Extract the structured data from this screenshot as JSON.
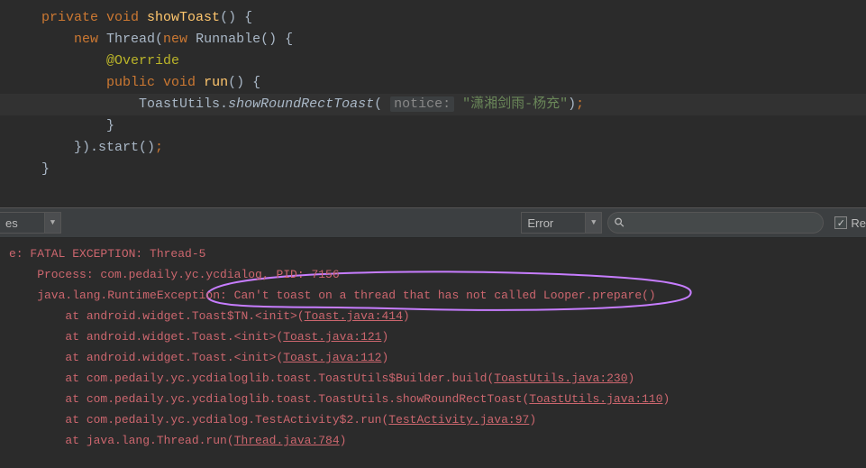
{
  "editor": {
    "lines": [
      {
        "indent": 1,
        "tokens": [
          {
            "cls": "kw",
            "t": "private void "
          },
          {
            "cls": "method-decl",
            "t": "showToast"
          },
          {
            "cls": "plain",
            "t": "() {"
          }
        ]
      },
      {
        "indent": 2,
        "tokens": [
          {
            "cls": "kw",
            "t": "new "
          },
          {
            "cls": "plain",
            "t": "Thread("
          },
          {
            "cls": "kw",
            "t": "new "
          },
          {
            "cls": "plain",
            "t": "Runnable() {"
          }
        ]
      },
      {
        "indent": 3,
        "tokens": [
          {
            "cls": "annotation",
            "t": "@Override"
          }
        ]
      },
      {
        "indent": 3,
        "tokens": [
          {
            "cls": "kw",
            "t": "public void "
          },
          {
            "cls": "method-decl",
            "t": "run"
          },
          {
            "cls": "plain",
            "t": "() {"
          }
        ]
      },
      {
        "indent": 4,
        "highlight": true,
        "tokens": [
          {
            "cls": "plain",
            "t": "ToastUtils."
          },
          {
            "cls": "static-call",
            "t": "showRoundRectToast"
          },
          {
            "cls": "plain",
            "t": "( "
          },
          {
            "cls": "param-hint",
            "t": "notice:"
          },
          {
            "cls": "plain",
            "t": " "
          },
          {
            "cls": "string",
            "t": "\"潇湘剑雨-杨充\""
          },
          {
            "cls": "plain",
            "t": ")"
          },
          {
            "cls": "kw",
            "t": ";"
          }
        ]
      },
      {
        "indent": 3,
        "tokens": [
          {
            "cls": "plain",
            "t": "}"
          }
        ]
      },
      {
        "indent": 2,
        "tokens": [
          {
            "cls": "plain",
            "t": "}).start()"
          },
          {
            "cls": "kw",
            "t": ";"
          }
        ]
      },
      {
        "indent": 1,
        "tokens": [
          {
            "cls": "plain",
            "t": "}"
          }
        ]
      }
    ]
  },
  "toolbar": {
    "left_combo": "es",
    "level": "Error",
    "regex_label": "Re"
  },
  "log": {
    "lines": [
      {
        "pad": 0,
        "pre": "e: ",
        "text": "FATAL EXCEPTION: Thread-5"
      },
      {
        "pad": 1,
        "text": "Process: com.pedaily.yc.ycdialog, PID: 7156"
      },
      {
        "pad": 1,
        "text": "java.lang.RuntimeException: Can't toast on a thread that has not called Looper.prepare()"
      },
      {
        "pad": 2,
        "text": "at android.widget.Toast$TN.<init>(",
        "link": "Toast.java:414",
        "after": ")"
      },
      {
        "pad": 2,
        "text": "at android.widget.Toast.<init>(",
        "link": "Toast.java:121",
        "after": ")"
      },
      {
        "pad": 2,
        "text": "at android.widget.Toast.<init>(",
        "link": "Toast.java:112",
        "after": ")"
      },
      {
        "pad": 2,
        "text": "at com.pedaily.yc.ycdialoglib.toast.ToastUtils$Builder.build(",
        "link": "ToastUtils.java:230",
        "after": ")"
      },
      {
        "pad": 2,
        "text": "at com.pedaily.yc.ycdialoglib.toast.ToastUtils.showRoundRectToast(",
        "link": "ToastUtils.java:110",
        "after": ")"
      },
      {
        "pad": 2,
        "text": "at com.pedaily.yc.ycdialog.TestActivity$2.run(",
        "link": "TestActivity.java:97",
        "after": ")"
      },
      {
        "pad": 2,
        "text": "at java.lang.Thread.run(",
        "link": "Thread.java:784",
        "after": ")"
      }
    ]
  }
}
